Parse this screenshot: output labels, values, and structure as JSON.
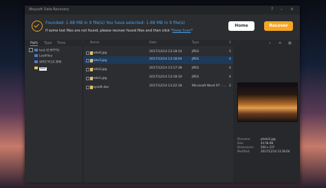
{
  "window": {
    "title": "iBoysoft Data Recovery",
    "controls": [
      "?",
      "–",
      "×"
    ]
  },
  "banner": {
    "found_line": "Founded: 1.68 MB in 9 file(s)  You have selected: 1.68 MB in 9 file(s)",
    "hint_prefix": "If some lost files are not found, please recover found files and then click \"",
    "hint_link": "Deep Scan",
    "hint_suffix": "\"",
    "home_label": "Home",
    "recover_label": "Recover"
  },
  "left_tabs": [
    "Path",
    "Type",
    "Time"
  ],
  "tree": [
    {
      "label": "test (E:NTFS)"
    },
    {
      "label": "LostFiles"
    },
    {
      "label": "$RECYCLE.BIN"
    },
    {
      "label": "test"
    }
  ],
  "table": {
    "headers": [
      "Name",
      "Date",
      "Type",
      "S"
    ],
    "rows": [
      {
        "name": "photo4.jpg",
        "date": "2017/12/14 13:18:14",
        "type": "JPEG",
        "size": "5"
      },
      {
        "name": "photo3.jpg",
        "date": "2017/12/14 13:18:04",
        "type": "JPEG",
        "size": "4"
      },
      {
        "name": "photo2.jpg",
        "date": "2017/12/14 13:17:38",
        "type": "JPEG",
        "size": "4"
      },
      {
        "name": "photo1.jpg",
        "date": "2017/12/14 13:18:10",
        "type": "JPEG",
        "size": "4"
      },
      {
        "name": "iboysoft.doc",
        "date": "2017/12/14 13:22:18",
        "type": "Microsoft Word 97 - ...",
        "size": "2"
      }
    ]
  },
  "preview": {
    "fields": [
      {
        "label": "Filename:",
        "value": "photo3.jpg"
      },
      {
        "label": "Size:",
        "value": "43.58 KB"
      },
      {
        "label": "Dimensions:",
        "value": "500 x 237"
      },
      {
        "label": "Modified:",
        "value": "2017/12/14 13:18:04"
      }
    ]
  },
  "colors": {
    "accent": "#f5a623",
    "link": "#4aa3e8",
    "selected_row": "#1d3a5a"
  }
}
